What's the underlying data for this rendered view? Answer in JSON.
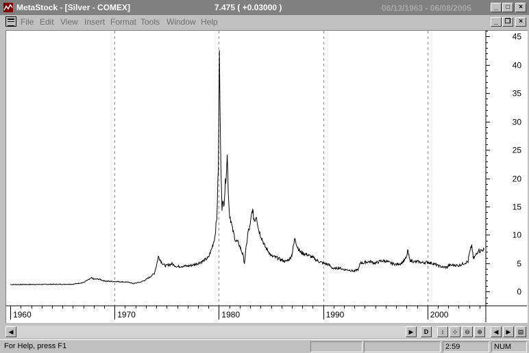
{
  "window": {
    "title": "MetaStock - [Silver - COMEX]",
    "price_readout": "7.475  ( +0.03000 )",
    "date_range": "06/13/1963 - 06/08/2005",
    "app_buttons": [
      "_",
      "□",
      "×"
    ],
    "doc_buttons": [
      "_",
      "❐",
      "×"
    ]
  },
  "menu": {
    "items": [
      "File",
      "Edit",
      "View",
      "Insert",
      "Format",
      "Tools",
      "Window",
      "Help"
    ]
  },
  "chart_data": {
    "type": "line",
    "series": [
      {
        "values_by_year": [
          [
            1960,
            1.25
          ],
          [
            1961,
            1.25
          ],
          [
            1962,
            1.26
          ],
          [
            1963,
            1.27
          ],
          [
            1964,
            1.29
          ],
          [
            1965,
            1.29
          ],
          [
            1965.5,
            1.3
          ],
          [
            1966,
            1.3
          ],
          [
            1966.5,
            1.45
          ],
          [
            1967,
            1.6
          ],
          [
            1967.4,
            2.0
          ],
          [
            1967.8,
            2.4
          ],
          [
            1968,
            2.2
          ],
          [
            1968.5,
            2.2
          ],
          [
            1969,
            1.9
          ],
          [
            1969.5,
            1.8
          ],
          [
            1970,
            1.8
          ],
          [
            1970.5,
            1.75
          ],
          [
            1971,
            1.7
          ],
          [
            1971.5,
            1.6
          ],
          [
            1971.8,
            1.4
          ],
          [
            1972,
            1.5
          ],
          [
            1972.5,
            1.7
          ],
          [
            1972.9,
            2.0
          ],
          [
            1973,
            2.1
          ],
          [
            1973.4,
            2.6
          ],
          [
            1973.8,
            3.2
          ],
          [
            1974,
            4.5
          ],
          [
            1974.2,
            6.2
          ],
          [
            1974.5,
            5.2
          ],
          [
            1974.8,
            4.6
          ],
          [
            1975,
            4.6
          ],
          [
            1975.5,
            4.9
          ],
          [
            1976,
            4.4
          ],
          [
            1976.5,
            4.5
          ],
          [
            1977,
            4.5
          ],
          [
            1977.5,
            4.7
          ],
          [
            1978,
            5.0
          ],
          [
            1978.5,
            5.4
          ],
          [
            1979,
            6.0
          ],
          [
            1979.3,
            7.5
          ],
          [
            1979.6,
            9.5
          ],
          [
            1979.8,
            13.0
          ],
          [
            1979.95,
            22.0
          ],
          [
            1980.05,
            42.0
          ],
          [
            1980.15,
            26.0
          ],
          [
            1980.3,
            15.0
          ],
          [
            1980.5,
            16.0
          ],
          [
            1980.7,
            21.0
          ],
          [
            1980.8,
            24.0
          ],
          [
            1980.9,
            18.0
          ],
          [
            1981,
            14.0
          ],
          [
            1981.3,
            11.0
          ],
          [
            1981.6,
            9.0
          ],
          [
            1981.9,
            8.5
          ],
          [
            1982,
            8.0
          ],
          [
            1982.3,
            6.5
          ],
          [
            1982.45,
            5.0
          ],
          [
            1982.6,
            7.5
          ],
          [
            1982.8,
            10.5
          ],
          [
            1983,
            11.5
          ],
          [
            1983.2,
            14.5
          ],
          [
            1983.4,
            12.5
          ],
          [
            1983.6,
            13.5
          ],
          [
            1983.8,
            11.0
          ],
          [
            1984,
            10.0
          ],
          [
            1984.4,
            8.0
          ],
          [
            1984.8,
            7.0
          ],
          [
            1985,
            6.3
          ],
          [
            1985.5,
            6.0
          ],
          [
            1986,
            5.6
          ],
          [
            1986.4,
            5.3
          ],
          [
            1986.8,
            5.8
          ],
          [
            1987,
            6.5
          ],
          [
            1987.3,
            9.5
          ],
          [
            1987.5,
            8.0
          ],
          [
            1987.8,
            7.0
          ],
          [
            1988,
            6.8
          ],
          [
            1988.5,
            6.5
          ],
          [
            1989,
            6.0
          ],
          [
            1989.5,
            5.4
          ],
          [
            1990,
            5.0
          ],
          [
            1990.5,
            4.8
          ],
          [
            1991,
            4.0
          ],
          [
            1991.5,
            4.2
          ],
          [
            1992,
            3.9
          ],
          [
            1992.5,
            3.8
          ],
          [
            1993,
            3.6
          ],
          [
            1993.4,
            4.0
          ],
          [
            1993.6,
            5.2
          ],
          [
            1993.9,
            5.0
          ],
          [
            1994,
            5.2
          ],
          [
            1994.5,
            5.3
          ],
          [
            1995,
            5.0
          ],
          [
            1995.5,
            5.4
          ],
          [
            1996,
            5.4
          ],
          [
            1996.5,
            5.0
          ],
          [
            1997,
            4.8
          ],
          [
            1997.5,
            5.0
          ],
          [
            1998,
            6.0
          ],
          [
            1998.1,
            7.3
          ],
          [
            1998.3,
            5.6
          ],
          [
            1998.8,
            5.2
          ],
          [
            1999,
            5.3
          ],
          [
            1999.5,
            5.1
          ],
          [
            2000,
            5.2
          ],
          [
            2000.5,
            5.0
          ],
          [
            2001,
            4.6
          ],
          [
            2001.5,
            4.3
          ],
          [
            2001.9,
            4.3
          ],
          [
            2002,
            4.6
          ],
          [
            2002.5,
            4.7
          ],
          [
            2003,
            4.6
          ],
          [
            2003.5,
            5.0
          ],
          [
            2003.9,
            5.3
          ],
          [
            2004,
            6.5
          ],
          [
            2004.25,
            8.2
          ],
          [
            2004.4,
            5.8
          ],
          [
            2004.7,
            6.6
          ],
          [
            2004.9,
            7.5
          ],
          [
            2005,
            7.1
          ],
          [
            2005.2,
            7.3
          ],
          [
            2005.44,
            7.475
          ]
        ]
      }
    ],
    "xlim": [
      1959.6,
      2005.6
    ],
    "ylim": [
      -2.5,
      46
    ],
    "y_ticks": [
      0,
      5,
      10,
      15,
      20,
      25,
      30,
      35,
      40,
      45
    ],
    "x_ticks": [
      1960,
      1970,
      1980,
      1990,
      2000
    ],
    "x_labels": [
      "1960",
      "1970",
      "1980",
      "1990",
      "2000"
    ],
    "vertical_gridlines": [
      1970,
      1980,
      1990,
      2000
    ],
    "grid_style": "dashed-vertical",
    "line_color": "#000000",
    "background": "#ffffff"
  },
  "scrollbar": {
    "left_arrow": "◀",
    "right_arrow": "▶",
    "toolbar_buttons": [
      "▶",
      "D",
      "↕",
      "⊹",
      "⊖",
      "⊕",
      "◀",
      "▶",
      "▤"
    ]
  },
  "status": {
    "help_text": "For Help, press F1",
    "time": "2:59",
    "num": "NUM"
  }
}
